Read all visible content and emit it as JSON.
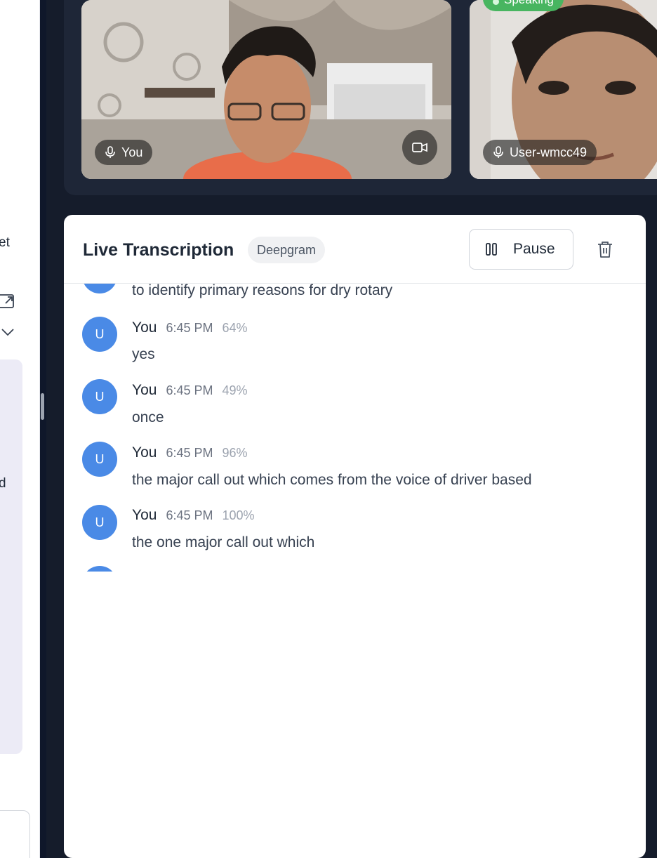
{
  "left_panel": {
    "fragment_top": "et",
    "fragment_mid": "d",
    "icons": [
      "external-link-icon",
      "chevron-down-icon"
    ]
  },
  "video": {
    "tiles": [
      {
        "name": "You",
        "mic_icon": "mic-icon",
        "camera_icon": "video-camera-icon"
      },
      {
        "name": "User-wmcc49",
        "mic_icon": "mic-icon",
        "status": "Speaking"
      }
    ]
  },
  "transcription": {
    "title": "Live Transcription",
    "provider": "Deepgram",
    "pause_label": "Pause",
    "pause_icon": "pause-icon",
    "delete_icon": "trash-icon",
    "partial_message": {
      "text": "to identify primary reasons for dry rotary"
    },
    "messages": [
      {
        "avatar": "U",
        "speaker": "You",
        "time": "6:45 PM",
        "confidence": "64%",
        "text": "yes"
      },
      {
        "avatar": "U",
        "speaker": "You",
        "time": "6:45 PM",
        "confidence": "49%",
        "text": "once"
      },
      {
        "avatar": "U",
        "speaker": "You",
        "time": "6:45 PM",
        "confidence": "96%",
        "text": "the major call out which comes from the voice of driver based"
      },
      {
        "avatar": "U",
        "speaker": "You",
        "time": "6:45 PM",
        "confidence": "100%",
        "text": "the one major call out which"
      }
    ]
  },
  "colors": {
    "avatar": "#4a8ae6",
    "speaking": "#48b560",
    "dark_bg": "#151c2b"
  }
}
